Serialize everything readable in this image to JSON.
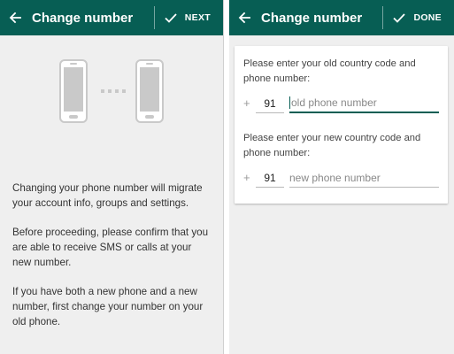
{
  "left": {
    "title": "Change number",
    "action_label": "NEXT",
    "paragraphs": [
      "Changing your phone number will migrate your account info, groups and settings.",
      "Before proceeding, please confirm that you are able to receive SMS or calls at your new number.",
      "If you have both a new phone and a new number, first change your number on your old phone."
    ]
  },
  "right": {
    "title": "Change number",
    "action_label": "DONE",
    "old": {
      "label": "Please enter your old country code and phone number:",
      "plus": "+",
      "country_code": "91",
      "placeholder": "old phone number"
    },
    "new": {
      "label": "Please enter your new country code and phone number:",
      "plus": "+",
      "country_code": "91",
      "placeholder": "new phone number"
    }
  },
  "colors": {
    "appbar": "#075e54",
    "background": "#efefef",
    "phone_illustration": "#c9c9c9"
  },
  "icons": [
    "arrow-back-icon",
    "check-icon",
    "phone-illustration-icon"
  ]
}
